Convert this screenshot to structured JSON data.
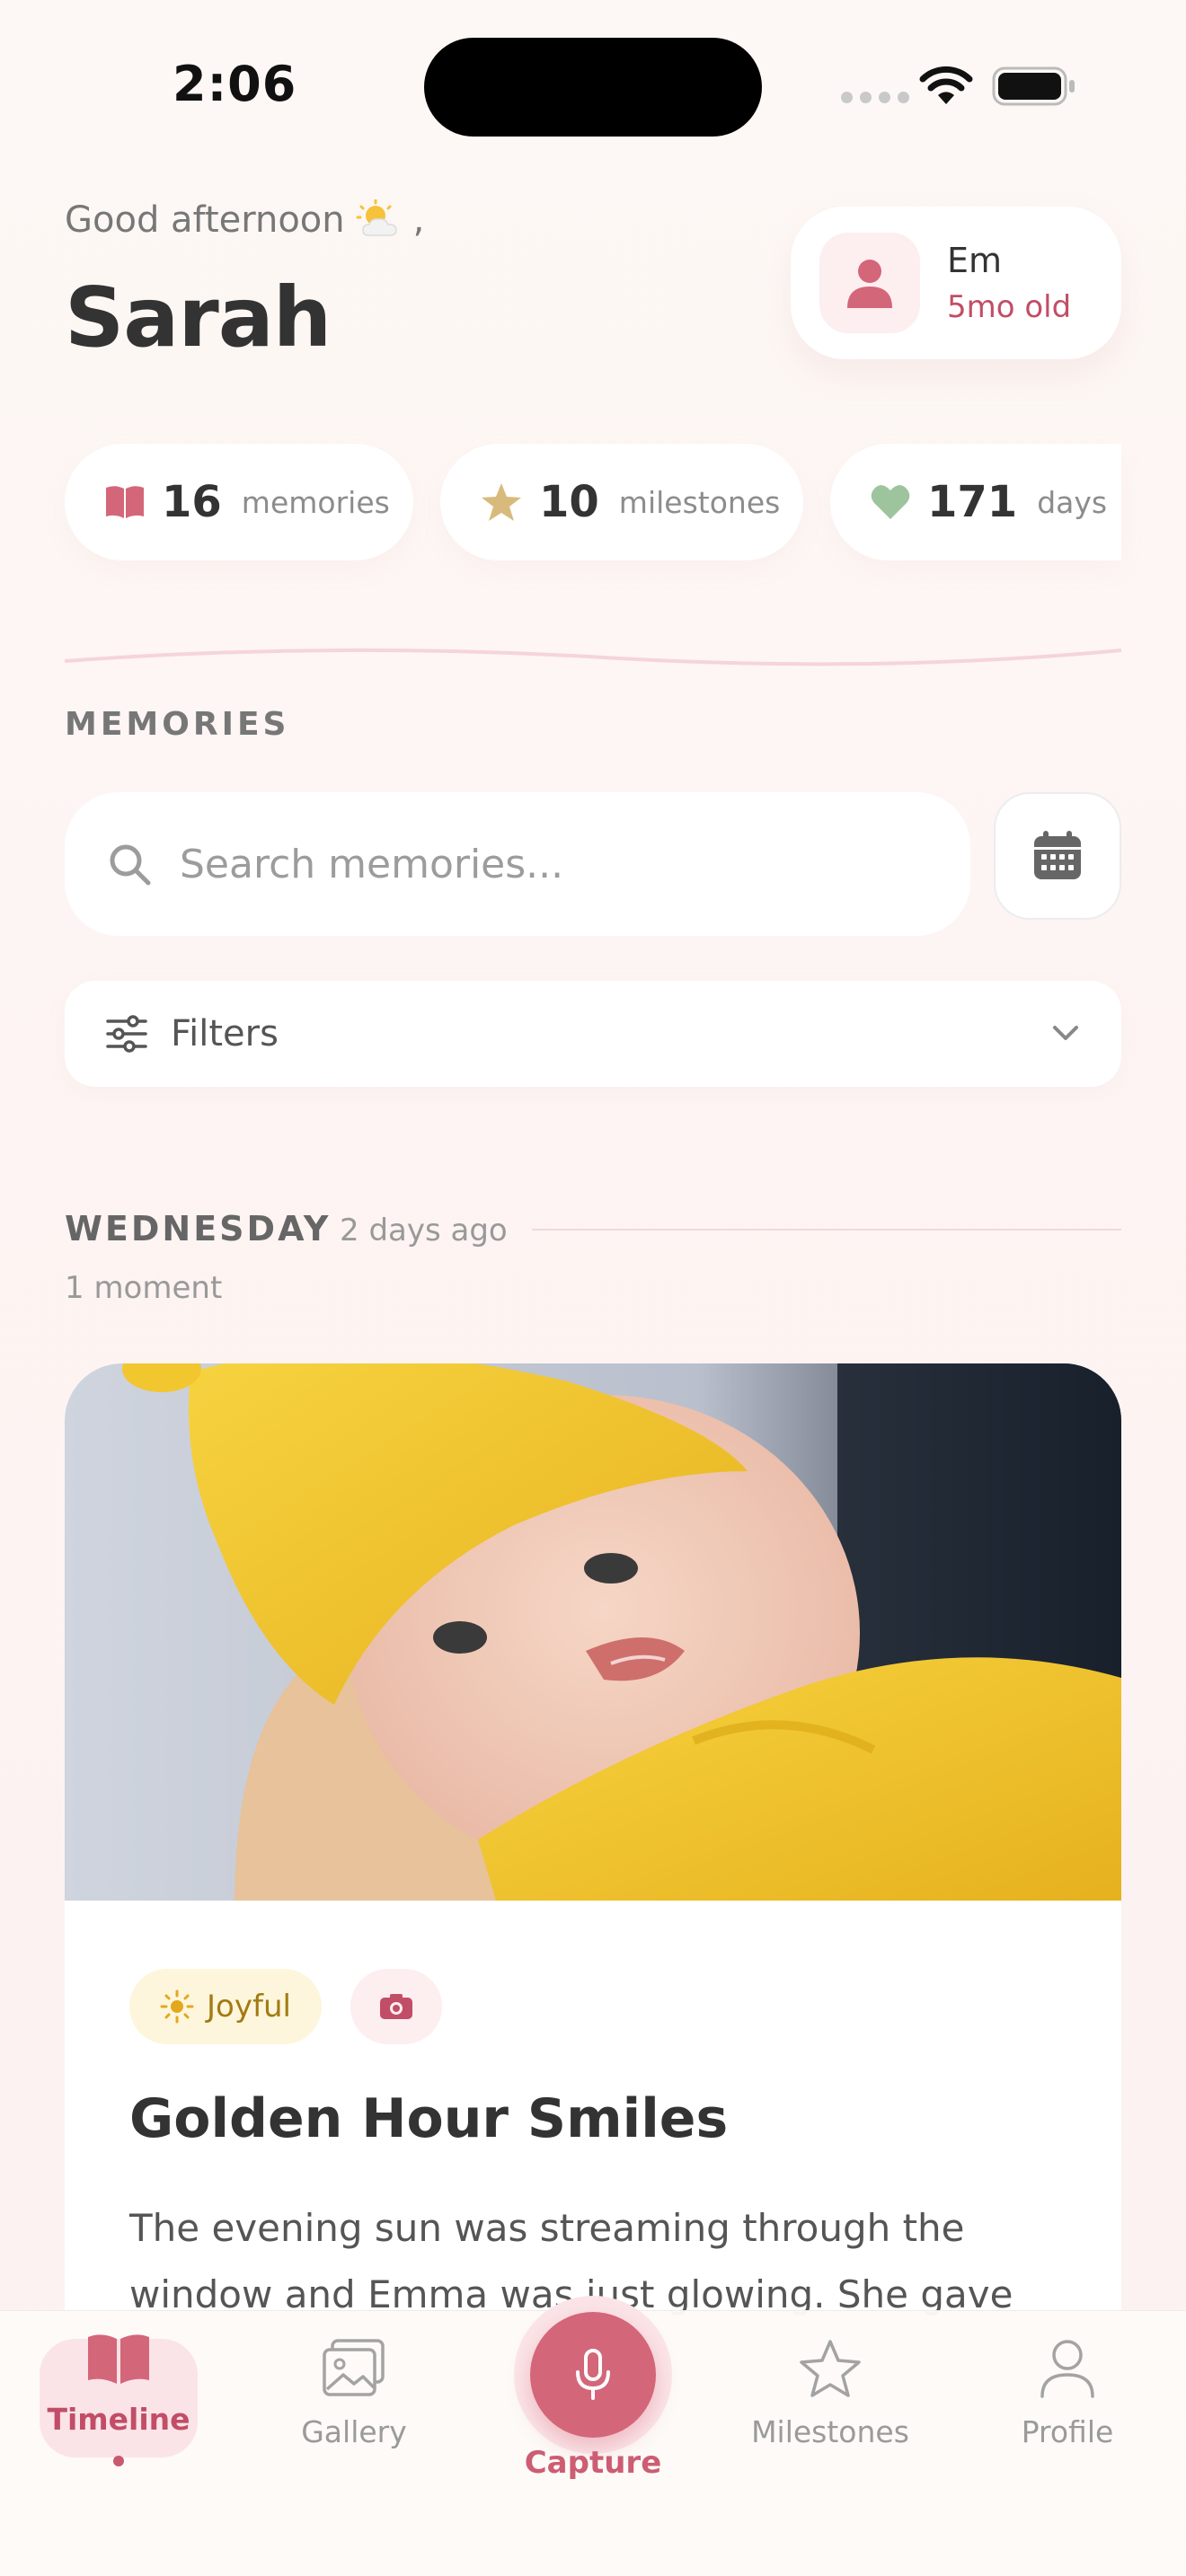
{
  "status_bar": {
    "time": "2:06"
  },
  "header": {
    "greeting": "Good afternoon",
    "greeting_suffix": ",",
    "greeting_icon": "sun-cloud-icon",
    "user_name": "Sarah"
  },
  "baby": {
    "name": "Em",
    "age": "5mo old"
  },
  "stats": [
    {
      "icon": "book-icon",
      "value": "16",
      "label": "memories",
      "color": "#d46679"
    },
    {
      "icon": "star-icon",
      "value": "10",
      "label": "milestones",
      "color": "#d8bb7c"
    },
    {
      "icon": "heart-icon",
      "value": "171",
      "label": "days",
      "color": "#9ec49e"
    }
  ],
  "memories": {
    "section_label": "MEMORIES",
    "search_placeholder": "Search memories...",
    "filters_label": "Filters"
  },
  "day_group": {
    "day": "WEDNESDAY",
    "relative": "2 days ago",
    "count": "1 moment"
  },
  "memory_card": {
    "mood": "Joyful",
    "media_icon": "camera-icon",
    "title": "Golden Hour Smiles",
    "body": "The evening sun was streaming through the window and Emma was just glowing. She gave"
  },
  "tabbar": {
    "tabs": [
      {
        "label": "Timeline",
        "icon": "book-icon",
        "active": true
      },
      {
        "label": "Gallery",
        "icon": "image-icon",
        "active": false
      },
      {
        "label": "Capture",
        "icon": "microphone-icon",
        "active": false
      },
      {
        "label": "Milestones",
        "icon": "star-icon",
        "active": false
      },
      {
        "label": "Profile",
        "icon": "person-icon",
        "active": false
      }
    ]
  },
  "colors": {
    "accent": "#d46679",
    "accent_text": "#c24d67",
    "background": "#fdf8f5",
    "joyful_bg": "#fdf6dc",
    "joyful_text": "#a37a12"
  }
}
